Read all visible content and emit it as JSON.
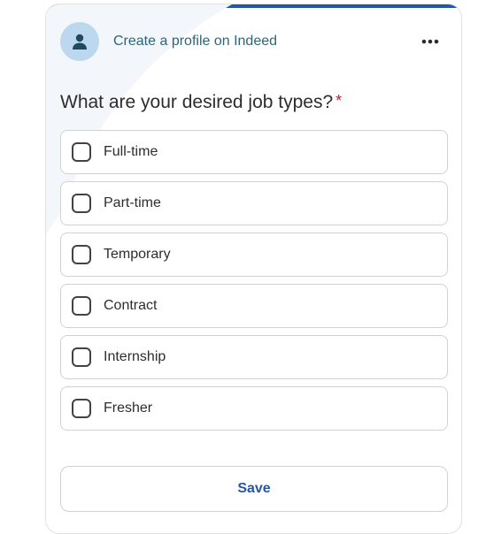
{
  "header": {
    "title": "Create a profile on Indeed",
    "avatar_icon": "person-icon",
    "more_icon": "more-horizontal-icon"
  },
  "question": {
    "text": "What are your desired job types?",
    "required_mark": "*"
  },
  "options": [
    {
      "label": "Full-time",
      "checked": false
    },
    {
      "label": "Part-time",
      "checked": false
    },
    {
      "label": "Temporary",
      "checked": false
    },
    {
      "label": "Contract",
      "checked": false
    },
    {
      "label": "Internship",
      "checked": false
    },
    {
      "label": "Fresher",
      "checked": false
    }
  ],
  "actions": {
    "save_label": "Save"
  },
  "colors": {
    "accent": "#2557a7",
    "avatar_bg": "#bcd8ef",
    "header_text": "#2d6578",
    "required": "#c9132e"
  }
}
